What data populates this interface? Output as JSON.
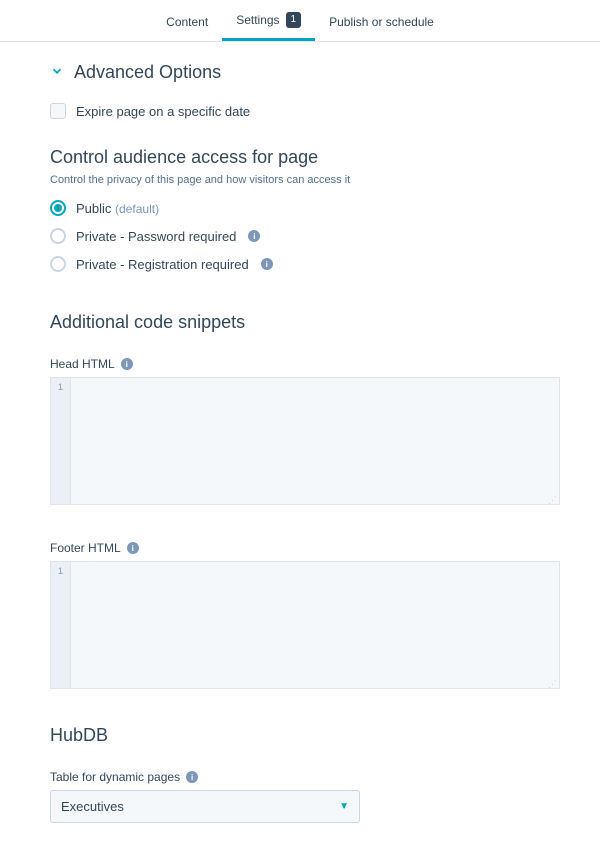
{
  "tabs": {
    "content": "Content",
    "settings": "Settings",
    "settings_badge": "1",
    "publish": "Publish or schedule"
  },
  "advanced": {
    "title": "Advanced Options"
  },
  "expire": {
    "label": "Expire page on a specific date"
  },
  "audience": {
    "heading": "Control audience access for page",
    "subtext": "Control the privacy of this page and how visitors can access it",
    "public": "Public",
    "default": "(default)",
    "private_password": "Private - Password required",
    "private_registration": "Private - Registration required"
  },
  "snippets": {
    "heading": "Additional code snippets",
    "head_label": "Head HTML",
    "footer_label": "Footer HTML",
    "line1": "1"
  },
  "hubdb": {
    "heading": "HubDB",
    "table_label": "Table for dynamic pages",
    "selected": "Executives"
  }
}
